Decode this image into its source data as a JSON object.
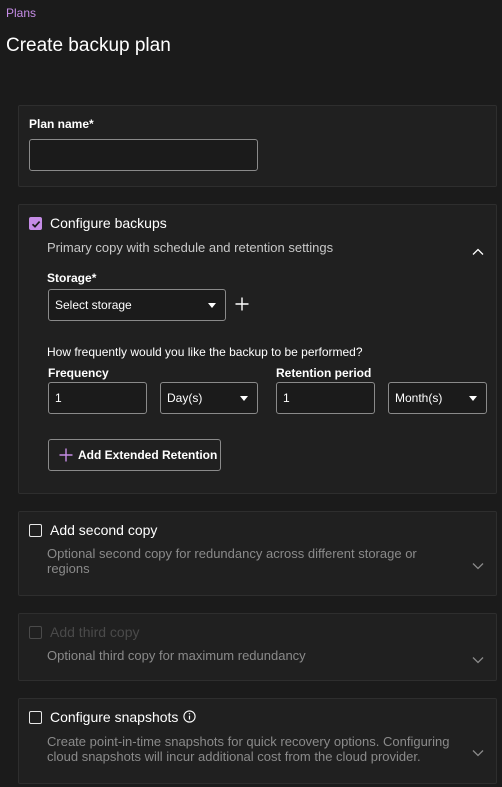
{
  "breadcrumb": {
    "label": "Plans"
  },
  "page": {
    "title": "Create backup plan"
  },
  "plan_name": {
    "label": "Plan name",
    "required_mark": "*",
    "value": "",
    "placeholder": ""
  },
  "configure_backups": {
    "checked": true,
    "title": "Configure backups",
    "description": "Primary copy with schedule and retention settings",
    "expanded": true,
    "storage": {
      "label": "Storage",
      "required_mark": "*",
      "selected": "Select storage"
    },
    "question": "How frequently would you like the backup to be performed?",
    "frequency": {
      "label": "Frequency",
      "value": "1",
      "unit": "Day(s)"
    },
    "retention": {
      "label": "Retention period",
      "value": "1",
      "unit": "Month(s)"
    },
    "add_extended_retention": "Add Extended Retention"
  },
  "second_copy": {
    "checked": false,
    "title": "Add second copy",
    "description": "Optional second copy for redundancy across different storage or regions"
  },
  "third_copy": {
    "checked": false,
    "disabled": true,
    "title": "Add third copy",
    "description": "Optional third copy for maximum redundancy"
  },
  "snapshots": {
    "checked": false,
    "title": "Configure snapshots",
    "description": "Create point-in-time snapshots for quick recovery options. Configuring cloud snapshots will incur additional cost from the cloud provider."
  },
  "colors": {
    "accent": "#c58ce6",
    "background": "#1b1b1b",
    "card": "#202020",
    "border": "#8a8a8a"
  },
  "icons": [
    "checkmark-icon",
    "plus-icon",
    "chevron-up-icon",
    "chevron-down-icon",
    "info-icon",
    "caret-down-icon"
  ]
}
